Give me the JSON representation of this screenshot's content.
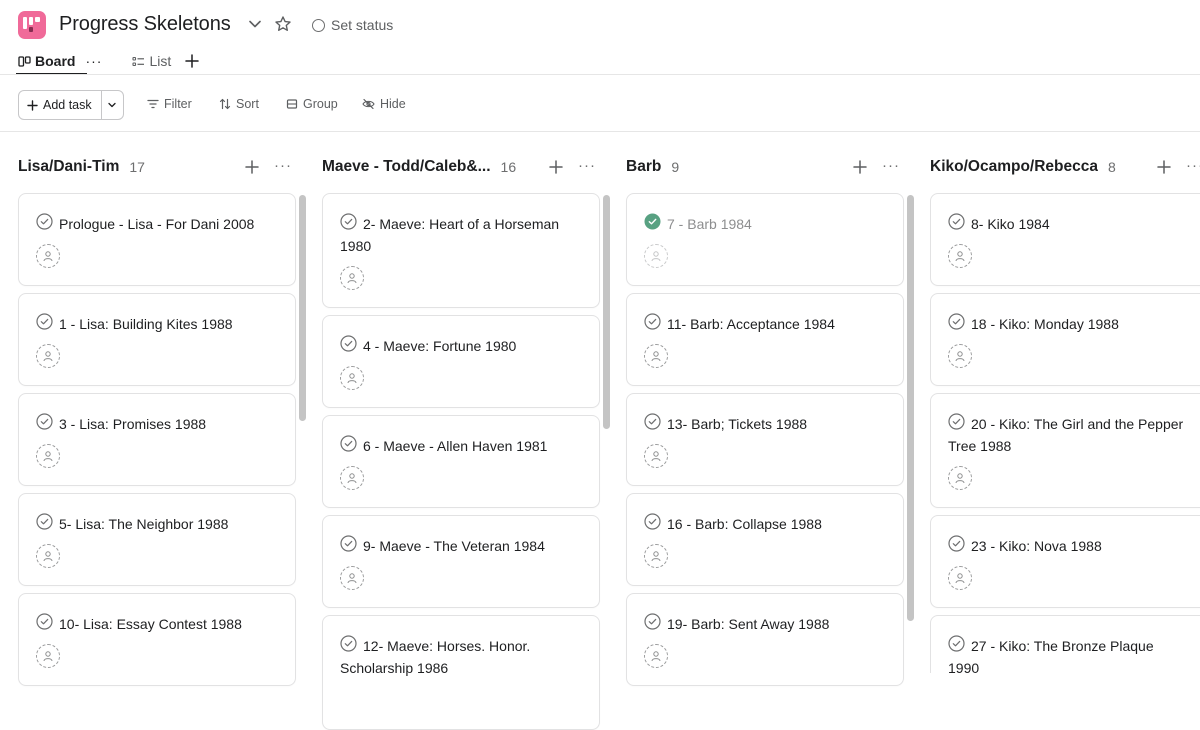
{
  "project": {
    "title": "Progress Skeletons",
    "set_status": "Set status",
    "logo_color": "#f06a99"
  },
  "tabs": [
    {
      "label": "Board",
      "active": true
    },
    {
      "label": "List",
      "active": false
    }
  ],
  "toolbar": {
    "add_task": "Add task",
    "filter": "Filter",
    "sort": "Sort",
    "group": "Group",
    "hide": "Hide"
  },
  "columns": [
    {
      "name": "Lisa/Dani-Tim",
      "count": "17",
      "cards": [
        {
          "title": "Prologue - Lisa - For Dani 2008",
          "completed": false
        },
        {
          "title": "1 - Lisa: Building Kites 1988",
          "completed": false
        },
        {
          "title": "3 - Lisa: Promises 1988",
          "completed": false
        },
        {
          "title": "5- Lisa: The Neighbor 1988",
          "completed": false
        },
        {
          "title": "10- Lisa: Essay Contest 1988",
          "completed": false
        }
      ]
    },
    {
      "name": "Maeve - Todd/Caleb&...",
      "count": "16",
      "cards": [
        {
          "title": "2- Maeve: Heart of a Horseman 1980",
          "completed": false
        },
        {
          "title": "4 - Maeve: Fortune 1980",
          "completed": false
        },
        {
          "title": "6 - Maeve - Allen Haven 1981",
          "completed": false
        },
        {
          "title": "9- Maeve - The Veteran 1984",
          "completed": false
        },
        {
          "title": "12- Maeve: Horses. Honor. Scholarship 1986",
          "completed": false
        }
      ]
    },
    {
      "name": "Barb",
      "count": "9",
      "cards": [
        {
          "title": "7 - Barb 1984",
          "completed": true
        },
        {
          "title": "11- Barb: Acceptance 1984",
          "completed": false
        },
        {
          "title": "13- Barb; Tickets 1988",
          "completed": false
        },
        {
          "title": "16 - Barb: Collapse 1988",
          "completed": false
        },
        {
          "title": "19- Barb: Sent Away 1988",
          "completed": false
        }
      ]
    },
    {
      "name": "Kiko/Ocampo/Rebecca",
      "count": "8",
      "cards": [
        {
          "title": "8- Kiko 1984",
          "completed": false
        },
        {
          "title": "18 - Kiko: Monday 1988",
          "completed": false
        },
        {
          "title": "20 - Kiko: The Girl and the Pepper Tree 1988",
          "completed": false
        },
        {
          "title": "23 - Kiko: Nova 1988",
          "completed": false
        },
        {
          "title": "27 - Kiko: The Bronze Plaque 1990",
          "completed": false
        }
      ]
    }
  ],
  "icons": {
    "check": "check-circle-icon",
    "avatar": "unassigned-user-icon"
  },
  "colors": {
    "completed_check": "#58a182",
    "text": "#1e1f21",
    "muted": "#6d6e6f"
  }
}
